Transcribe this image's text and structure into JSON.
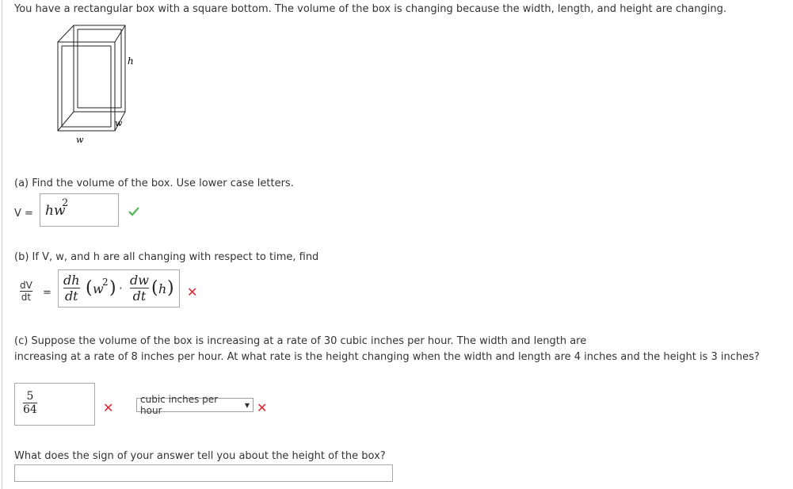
{
  "intro": "You have a rectangular box with a square bottom. The volume of the box is changing because the width, length, and height are changing.",
  "figure": {
    "label_h": "h",
    "label_w_front": "w",
    "label_w_side": "w"
  },
  "part_a": {
    "question": "(a) Find the volume of the box. Use lower case letters.",
    "lhs": "V =",
    "answer_base": "hw",
    "answer_exp": "2",
    "status": "correct"
  },
  "part_b": {
    "question": "(b) If V, w, and h are all changing with respect to time, find",
    "lhs_num": "dV",
    "lhs_den": "dt",
    "equals": "=",
    "ans_frac1_num": "dh",
    "ans_frac1_den": "dt",
    "ans_paren1_base": "w",
    "ans_paren1_exp": "2",
    "ans_dot": "·",
    "ans_frac2_num": "dw",
    "ans_frac2_den": "dt",
    "ans_paren2": "h",
    "status": "incorrect"
  },
  "part_c": {
    "question_line1": "(c) Suppose the volume of the box is increasing at a rate of 30 cubic inches per hour. The width and length are",
    "question_line2": "increasing at a rate of 8 inches per hour. At what rate is the height changing when the width and length are 4 inches and the height is 3 inches?",
    "answer_num": "5",
    "answer_den": "64",
    "answer_status": "incorrect",
    "unit_selected": "cubic inches per hour",
    "unit_status": "incorrect",
    "followup": "What does the sign of your answer tell you about the height of the box?",
    "followup_value": ""
  },
  "colors": {
    "check": "#5cb85c",
    "cross": "#e0232b"
  },
  "icons": {
    "correct": "check-icon",
    "incorrect": "cross-icon",
    "dropdown": "dropdown-arrow-icon"
  }
}
